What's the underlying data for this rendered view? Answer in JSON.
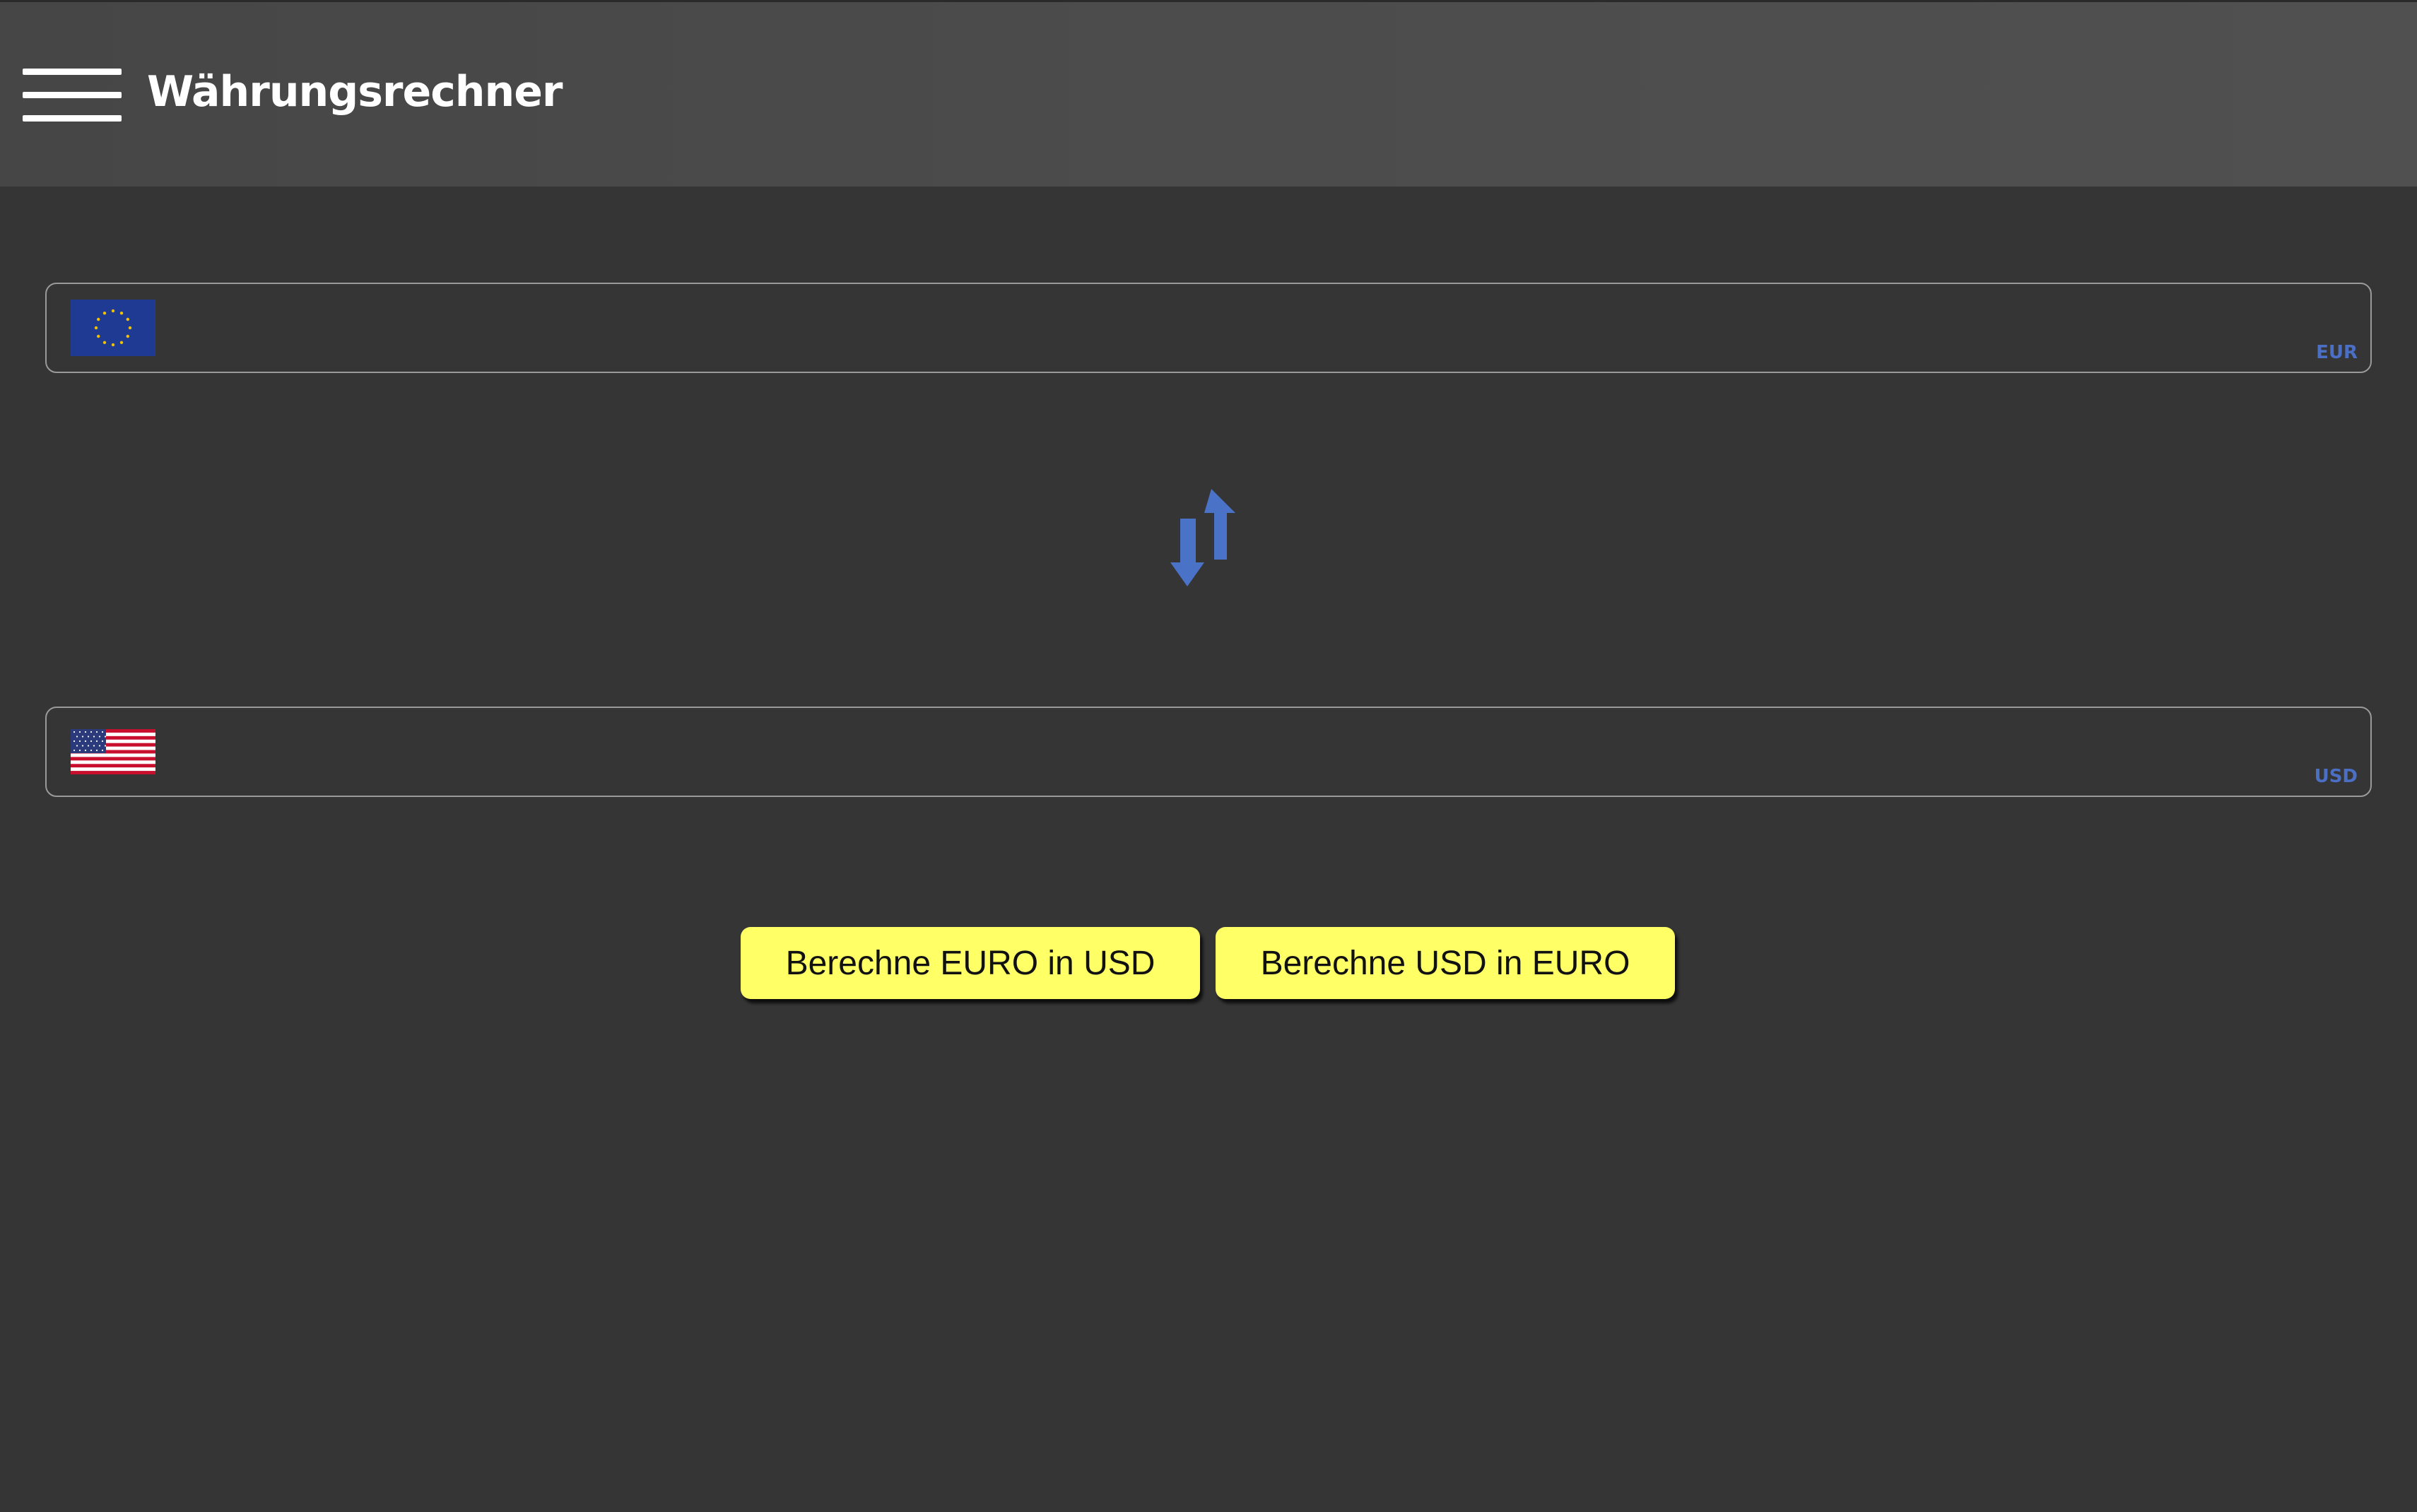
{
  "header": {
    "title": "Währungsrechner",
    "menu_icon": "hamburger-menu-icon"
  },
  "converter": {
    "eur": {
      "value": "",
      "code": "EUR",
      "flag_icon": "eu-flag-icon"
    },
    "swap_icon": "swap-arrows-icon",
    "usd": {
      "value": "",
      "code": "USD",
      "flag_icon": "us-flag-icon"
    }
  },
  "buttons": {
    "eur_to_usd": "Berechne EURO in USD",
    "usd_to_eur": "Berechne USD in EURO"
  },
  "colors": {
    "background": "#353535",
    "header": "#4b4b4b",
    "accent_blue": "#4a6fc4",
    "button_yellow": "#ffff66"
  }
}
